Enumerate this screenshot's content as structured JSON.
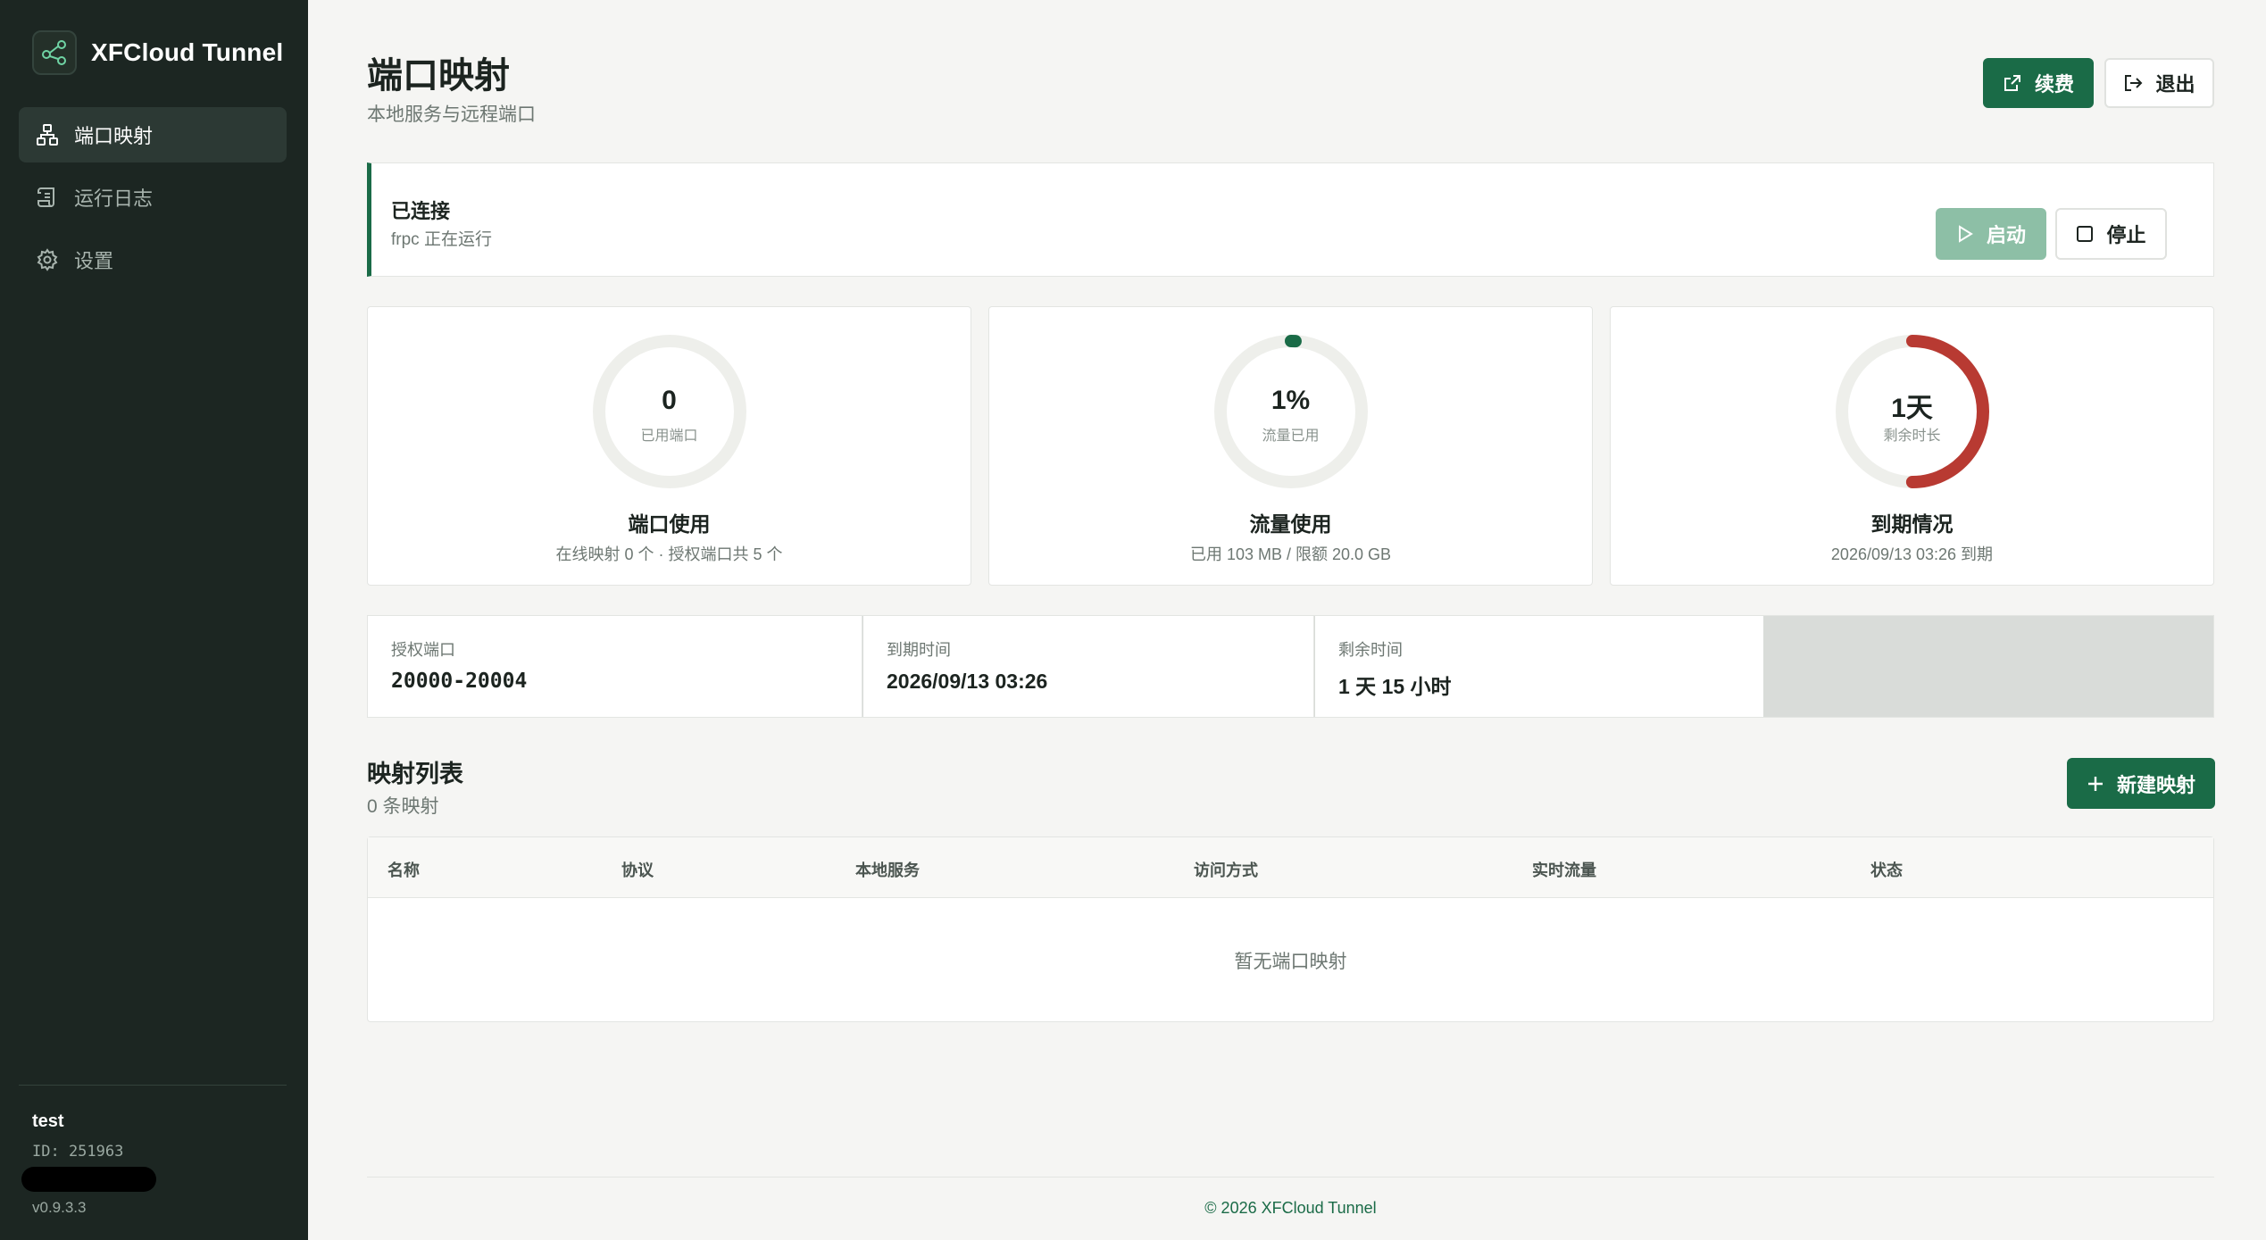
{
  "app": {
    "name": "XFCloud Tunnel",
    "logo_icon": "share-nodes-icon",
    "accent": "#1a6b47"
  },
  "sidebar": {
    "items": [
      {
        "label": "端口映射",
        "icon": "sitemap-icon",
        "active": true
      },
      {
        "label": "运行日志",
        "icon": "scroll-icon",
        "active": false
      },
      {
        "label": "设置",
        "icon": "gear-icon",
        "active": false
      }
    ],
    "user": {
      "name": "test",
      "id": "ID: 251963"
    },
    "version": "v0.9.3.3"
  },
  "header": {
    "title": "端口映射",
    "subtitle": "本地服务与远程端口",
    "renew_label": "续费",
    "logout_label": "退出"
  },
  "status": {
    "title": "已连接",
    "subtitle": "frpc 正在运行",
    "start_label": "启动",
    "stop_label": "停止",
    "color": "#1a6b47"
  },
  "cards": [
    {
      "value": "0",
      "label": "已用端口",
      "title": "端口使用",
      "subtitle": "在线映射 0 个 · 授权端口共 5 个",
      "fraction": 0,
      "color": "#1a6b47"
    },
    {
      "value": "1%",
      "label": "流量已用",
      "title": "流量使用",
      "subtitle": "已用 103 MB / 限额 20.0 GB",
      "fraction": 0.01,
      "color": "#1a6b47"
    },
    {
      "value": "1天",
      "label": "剩余时长",
      "title": "到期情况",
      "subtitle": "2026/09/13 03:26 到期",
      "fraction": 0.5,
      "color": "#b83a32"
    }
  ],
  "info": [
    {
      "label": "授权端口",
      "value": "20000-20004"
    },
    {
      "label": "到期时间",
      "value": "2026/09/13 03:26"
    },
    {
      "label": "剩余时间",
      "value": "1 天 15 小时"
    }
  ],
  "mappings": {
    "title": "映射列表",
    "count": "0 条映射",
    "new_label": "新建映射",
    "columns": [
      "名称",
      "协议",
      "本地服务",
      "访问方式",
      "实时流量",
      "状态"
    ],
    "empty": "暂无端口映射",
    "rows": []
  },
  "footer": "© 2026 XFCloud Tunnel"
}
